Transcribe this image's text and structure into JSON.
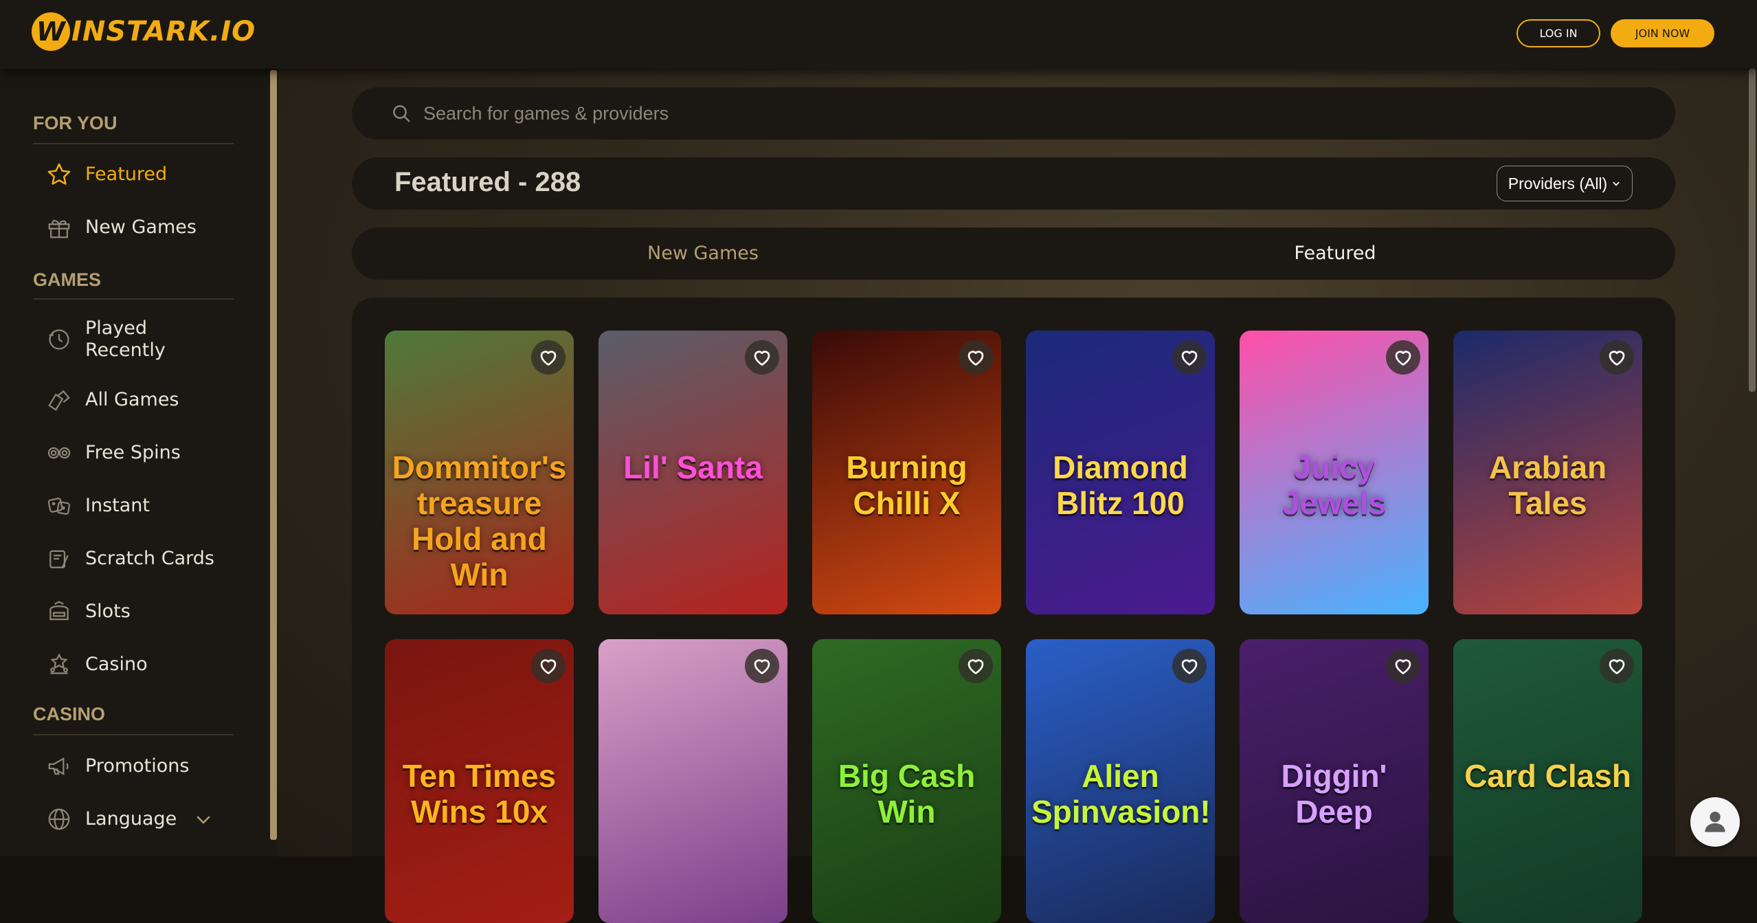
{
  "header": {
    "logo_w": "W",
    "logo_text": "INSTARK.IO",
    "login_label": "LOG IN",
    "join_label": "JOIN NOW"
  },
  "sidebar": {
    "sections": [
      {
        "title": "FOR YOU",
        "items": [
          {
            "label": "Featured",
            "icon": "star-icon",
            "active": true
          },
          {
            "label": "New Games",
            "icon": "gift-icon"
          }
        ]
      },
      {
        "title": "GAMES",
        "items": [
          {
            "label": "Played Recently",
            "icon": "history-icon"
          },
          {
            "label": "All Games",
            "icon": "cards-icon"
          },
          {
            "label": "Free Spins",
            "icon": "chips-icon"
          },
          {
            "label": "Instant",
            "icon": "dice-icon"
          },
          {
            "label": "Scratch Cards",
            "icon": "scratch-card-icon"
          },
          {
            "label": "Slots",
            "icon": "slot-machine-icon"
          },
          {
            "label": "Casino",
            "icon": "casino-icon"
          }
        ]
      },
      {
        "title": "CASINO",
        "items": [
          {
            "label": "Promotions",
            "icon": "megaphone-icon"
          },
          {
            "label": "Language",
            "icon": "globe-icon"
          }
        ]
      }
    ]
  },
  "search": {
    "placeholder": "Search for games & providers"
  },
  "title_bar": {
    "title": "Featured - 288",
    "providers_label": "Providers (All)"
  },
  "tabs": [
    {
      "label": "New Games"
    },
    {
      "label": "Featured"
    }
  ],
  "games": [
    {
      "title": "Dommitor's treasure Hold and Win",
      "bg": "#4f7a3a",
      "bg2": "#a8261b",
      "fg": "#f6a41e"
    },
    {
      "title": "Lil' Santa",
      "bg": "#5a5e6a",
      "bg2": "#b5231f",
      "fg": "#ff4fd8"
    },
    {
      "title": "Burning Chilli X",
      "bg": "#3a0a08",
      "bg2": "#d44a12",
      "fg": "#ffcc2e"
    },
    {
      "title": "Diamond Blitz 100",
      "bg": "#1b2a7a",
      "bg2": "#4b1a8f",
      "fg": "#ffd84a"
    },
    {
      "title": "Juicy Jewels",
      "bg": "#ff4fa8",
      "bg2": "#48b3ff",
      "fg": "#b04fe0"
    },
    {
      "title": "Arabian Tales",
      "bg": "#1c2a6a",
      "bg2": "#b8443a",
      "fg": "#f4c24a"
    },
    {
      "title": "Ten Times Wins 10x",
      "bg": "#7a1610",
      "bg2": "#a41e14",
      "fg": "#ffb31e"
    },
    {
      "title": "",
      "bg": "#d9a0c8",
      "bg2": "#7a3f8a",
      "fg": "#ffffff"
    },
    {
      "title": "Big Cash Win",
      "bg": "#2f6a24",
      "bg2": "#1a3f14",
      "fg": "#8ef03a"
    },
    {
      "title": "Alien Spinvasion!",
      "bg": "#2a5fc8",
      "bg2": "#1a2a5a",
      "fg": "#c8f53a"
    },
    {
      "title": "Diggin' Deep",
      "bg": "#4a1f6a",
      "bg2": "#2a1440",
      "fg": "#d8a0ff"
    },
    {
      "title": "Card Clash",
      "bg": "#1f5a3a",
      "bg2": "#133a25",
      "fg": "#f4d24a"
    }
  ],
  "colors": {
    "accent": "#f2ac12",
    "muted_gold": "#b59f72",
    "panel": "#1b1813"
  }
}
